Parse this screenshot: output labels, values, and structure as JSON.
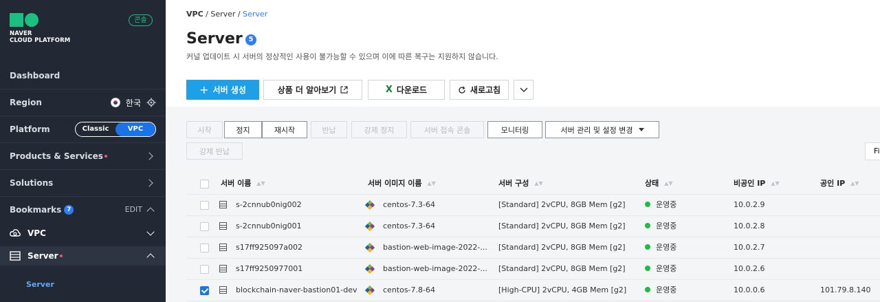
{
  "sidebar": {
    "logo": {
      "line1": "NAVER",
      "line2": "CLOUD PLATFORM"
    },
    "console_badge": "콘솔",
    "dashboard": "Dashboard",
    "region": {
      "label": "Region",
      "value": "한국"
    },
    "platform": {
      "label": "Platform",
      "options": [
        "Classic",
        "VPC"
      ],
      "selected": "VPC"
    },
    "products": "Products & Services",
    "solutions": "Solutions",
    "bookmarks": {
      "label": "Bookmarks",
      "count": "7",
      "edit": "EDIT"
    },
    "vpc": "VPC",
    "server": "Server",
    "server_sub": "Server"
  },
  "breadcrumb": {
    "items": [
      "VPC",
      "Server"
    ],
    "current": "Server"
  },
  "page": {
    "title": "Server",
    "count": "5",
    "subtitle": "커널 업데이트 시 서버의 정상적인 사용이 불가능할 수 있으며 이에 따른 복구는 지원하지 않습니다."
  },
  "toolbar": {
    "create": "서버 생성",
    "learn_more": "상품 더 알아보기",
    "download": "다운로드",
    "refresh": "새로고침"
  },
  "actions": {
    "start": "시작",
    "stop": "정지",
    "restart": "재시작",
    "return": "반납",
    "force_stop": "강제 정지",
    "console": "서버 접속 콘솔",
    "monitoring": "모니터링",
    "manage": "서버 관리 및 설정 변경",
    "force_return": "강제 반납",
    "filter": "Fi"
  },
  "table": {
    "headers": [
      "서버 이름",
      "서버 이미지 이름",
      "서버 구성",
      "상태",
      "비공인 IP",
      "공인 IP"
    ],
    "rows": [
      {
        "checked": false,
        "name": "s-2cnnub0nig002",
        "image": "centos-7.3-64",
        "spec": "[Standard] 2vCPU, 8GB Mem [g2]",
        "status": "운영중",
        "private_ip": "10.0.2.9",
        "public_ip": ""
      },
      {
        "checked": false,
        "name": "s-2cnnub0nig001",
        "image": "centos-7.3-64",
        "spec": "[Standard] 2vCPU, 8GB Mem [g2]",
        "status": "운영중",
        "private_ip": "10.0.2.8",
        "public_ip": ""
      },
      {
        "checked": false,
        "name": "s17ff925097a002",
        "image": "bastion-web-image-2022-...",
        "spec": "[Standard] 2vCPU, 8GB Mem [g2]",
        "status": "운영중",
        "private_ip": "10.0.2.7",
        "public_ip": ""
      },
      {
        "checked": false,
        "name": "s17ff9250977001",
        "image": "bastion-web-image-2022-...",
        "spec": "[Standard] 2vCPU, 8GB Mem [g2]",
        "status": "운영중",
        "private_ip": "10.0.2.6",
        "public_ip": ""
      },
      {
        "checked": true,
        "name": "blockchain-naver-bastion01-dev",
        "image": "centos-7.8-64",
        "spec": "[High-CPU] 2vCPU, 4GB Mem [g2]",
        "status": "운영중",
        "private_ip": "10.0.0.6",
        "public_ip": "101.79.8.140"
      }
    ]
  },
  "colors": {
    "accent": "#1ea0e8",
    "sidebar_bg": "#222834",
    "status_running": "#1bbf40",
    "brand": "#1bbf80"
  }
}
